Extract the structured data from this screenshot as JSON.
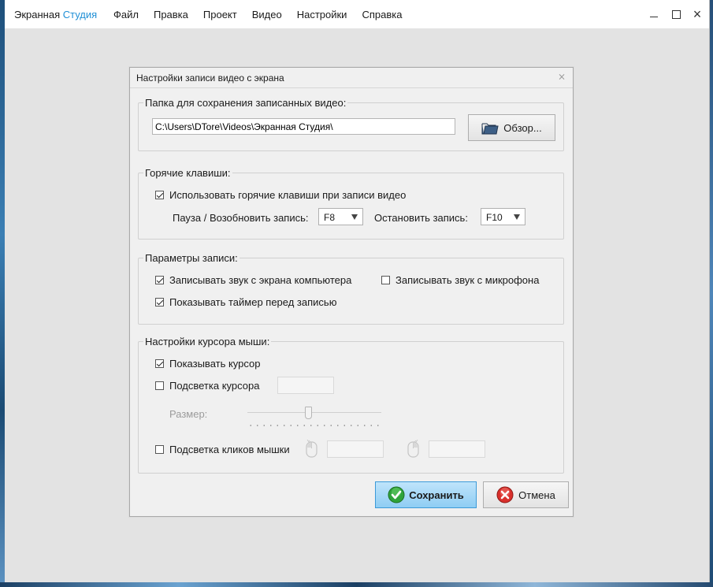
{
  "app": {
    "title_part1": "Экранная ",
    "title_part2": "Студия",
    "accent_color": "#1f8fd6"
  },
  "menu": [
    {
      "label": "Файл"
    },
    {
      "label": "Правка"
    },
    {
      "label": "Проект"
    },
    {
      "label": "Видео"
    },
    {
      "label": "Настройки"
    },
    {
      "label": "Справка"
    }
  ],
  "window_controls": {
    "minimize": "minimize-icon",
    "maximize": "maximize-icon",
    "close": "×"
  },
  "dialog": {
    "title": "Настройки записи видео с экрана",
    "close_glyph": "⨯",
    "save_folder": {
      "legend": "Папка для сохранения записанных видео:",
      "path": "C:\\Users\\DTore\\Videos\\Экранная Студия\\",
      "browse_label": "Обзор..."
    },
    "hotkeys": {
      "legend": "Горячие клавиши:",
      "use_hotkeys_label": "Использовать горячие клавиши при записи видео",
      "use_hotkeys_checked": true,
      "pause_label": "Пауза / Возобновить запись:",
      "pause_key": "F8",
      "stop_label": "Остановить запись:",
      "stop_key": "F10"
    },
    "recording": {
      "legend": "Параметры записи:",
      "record_system_audio_label": "Записывать звук с экрана компьютера",
      "record_system_audio_checked": true,
      "record_mic_label": "Записывать звук с микрофона",
      "record_mic_checked": false,
      "show_timer_label": "Показывать таймер перед записью",
      "show_timer_checked": true
    },
    "cursor": {
      "legend": "Настройки курсора мыши:",
      "show_cursor_label": "Показывать курсор",
      "show_cursor_checked": true,
      "highlight_cursor_label": "Подсветка курсора",
      "highlight_cursor_checked": false,
      "size_label": "Размер:",
      "size_value": 0.45,
      "highlight_clicks_label": "Подсветка кликов мышки",
      "highlight_clicks_checked": false
    },
    "buttons": {
      "save_label": "Сохранить",
      "cancel_label": "Отмена"
    }
  }
}
